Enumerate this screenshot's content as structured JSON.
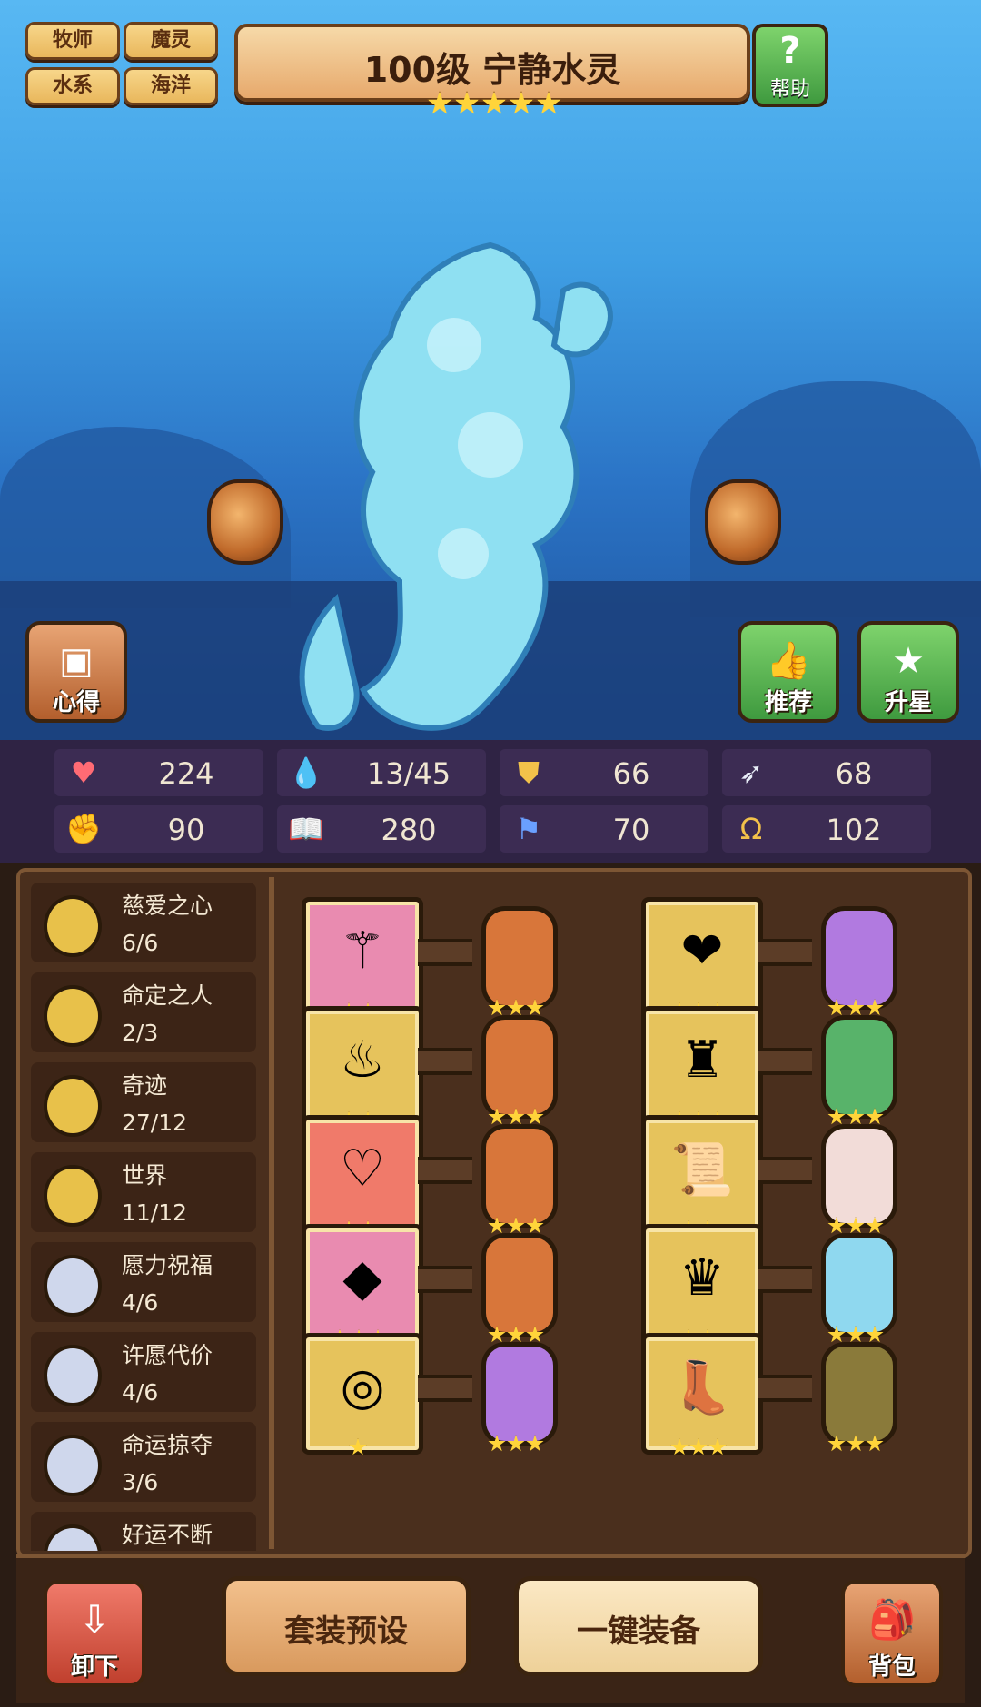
{
  "tags": [
    "牧师",
    "魔灵",
    "水系",
    "海洋"
  ],
  "hero": {
    "title": "100级  宁静水灵",
    "stars": 5
  },
  "help_label": "帮助",
  "side_buttons": {
    "insight": "心得",
    "recommend": "推荐",
    "star_up": "升星"
  },
  "stats": [
    {
      "icon": "heart-icon",
      "value": "224"
    },
    {
      "icon": "water-drop-icon",
      "value": "13/45"
    },
    {
      "icon": "shield-icon",
      "value": "66"
    },
    {
      "icon": "wing-icon",
      "value": "68"
    },
    {
      "icon": "fist-icon",
      "value": "90"
    },
    {
      "icon": "book-icon",
      "value": "280"
    },
    {
      "icon": "banner-icon",
      "value": "70"
    },
    {
      "icon": "horseshoe-icon",
      "value": "102"
    }
  ],
  "sets": [
    {
      "name": "慈爱之心",
      "count": "6/6",
      "medal": "gold"
    },
    {
      "name": "命定之人",
      "count": "2/3",
      "medal": "gold"
    },
    {
      "name": "奇迹",
      "count": "27/12",
      "medal": "gold"
    },
    {
      "name": "世界",
      "count": "11/12",
      "medal": "gold"
    },
    {
      "name": "愿力祝福",
      "count": "4/6",
      "medal": "silver"
    },
    {
      "name": "许愿代价",
      "count": "4/6",
      "medal": "silver"
    },
    {
      "name": "命运掠夺",
      "count": "3/6",
      "medal": "silver"
    },
    {
      "name": "好运不断",
      "count": "",
      "medal": "silver"
    }
  ],
  "equipment": [
    {
      "item": "wand-icon",
      "bg": "pink",
      "item_stars": 2,
      "rune_color": "orange",
      "rune_stars": 3
    },
    {
      "item": "heart-amulet-icon",
      "bg": "gold",
      "item_stars": 3,
      "rune_color": "purple",
      "rune_stars": 3
    },
    {
      "item": "magic-lamp-icon",
      "bg": "gold",
      "item_stars": 2,
      "rune_color": "orange",
      "rune_stars": 3
    },
    {
      "item": "golden-armor-icon",
      "bg": "gold",
      "item_stars": 3,
      "rune_color": "green",
      "rune_stars": 3
    },
    {
      "item": "heart-necklace-icon",
      "bg": "red",
      "item_stars": 2,
      "rune_color": "orange",
      "rune_stars": 3
    },
    {
      "item": "scroll-icon",
      "bg": "gold",
      "item_stars": 2,
      "rune_color": "white",
      "rune_stars": 3
    },
    {
      "item": "gem-ornament-icon",
      "bg": "pink",
      "item_stars": 3,
      "rune_color": "orange",
      "rune_stars": 3
    },
    {
      "item": "crystal-crown-icon",
      "bg": "gold",
      "item_stars": 2,
      "rune_color": "cyan",
      "rune_stars": 3
    },
    {
      "item": "ring-icon",
      "bg": "gold",
      "item_stars": 1,
      "rune_color": "purple",
      "rune_stars": 3
    },
    {
      "item": "golden-boots-icon",
      "bg": "gold",
      "item_stars": 3,
      "rune_color": "olive",
      "rune_stars": 3
    }
  ],
  "bottom": {
    "unequip": "卸下",
    "set_preset": "套装预设",
    "auto_equip": "一键装备",
    "bag": "背包"
  },
  "colors": {
    "pink": "#e98bb0",
    "gold": "#e6c35c",
    "red": "#f07a6a",
    "orange": "#d8763a",
    "purple": "#b17ae0",
    "green": "#58b36a",
    "white": "#f2dcd8",
    "cyan": "#8fd8ef",
    "olive": "#8a7a3a",
    "medal_gold": "#e8c14a",
    "medal_silver": "#cfd7ec"
  }
}
